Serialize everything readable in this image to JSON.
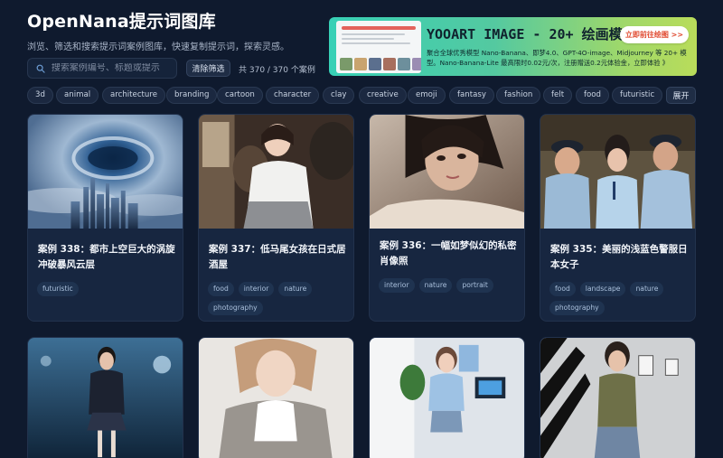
{
  "header": {
    "title": "OpenNana提示词图库",
    "subtitle": "浏览、筛选和搜索提示词案例图库，快速复制提示词，探索灵感。"
  },
  "search": {
    "placeholder": "搜索案例编号、标题或提示",
    "value": "",
    "clear_label": "清除筛选",
    "count_text": "共 370 / 370 个案例"
  },
  "ad": {
    "title": "YOOART IMAGE - 20+ 绘画模型",
    "description": "聚合全球优秀模型 Nano-Banana、即梦4.0、GPT-4O-image、Midjourney 等 20+ 模型。Nano-Banana-Lite 最高限时0.02元/次，注册赠送0.2元体验金，立即体验 》",
    "button_label": "立即前往绘图 >>",
    "colors": {
      "gradient_start": "#37d0b6",
      "gradient_end": "#b9dc5a",
      "button_text": "#e0492f"
    }
  },
  "tag_filters": [
    "3d",
    "animal",
    "architecture",
    "branding",
    "cartoon",
    "character",
    "clay",
    "creative",
    "emoji",
    "fantasy",
    "fashion",
    "felt",
    "food",
    "futuristic"
  ],
  "expand_label": "展开",
  "cards": [
    {
      "title": "案例 338：都市上空巨大的涡旋冲破暴风云层",
      "tags": [
        "futuristic"
      ]
    },
    {
      "title": "案例 337：低马尾女孩在日式居酒屋",
      "tags": [
        "food",
        "interior",
        "nature",
        "photography"
      ]
    },
    {
      "title": "案例 336：一幅如梦似幻的私密肖像照",
      "tags": [
        "interior",
        "nature",
        "portrait"
      ]
    },
    {
      "title": "案例 335：美丽的浅蓝色警服日本女子",
      "tags": [
        "food",
        "landscape",
        "nature",
        "photography"
      ]
    }
  ],
  "colors": {
    "background": "#0f1a2e",
    "card": "#172640",
    "chip": "#1f3350"
  }
}
